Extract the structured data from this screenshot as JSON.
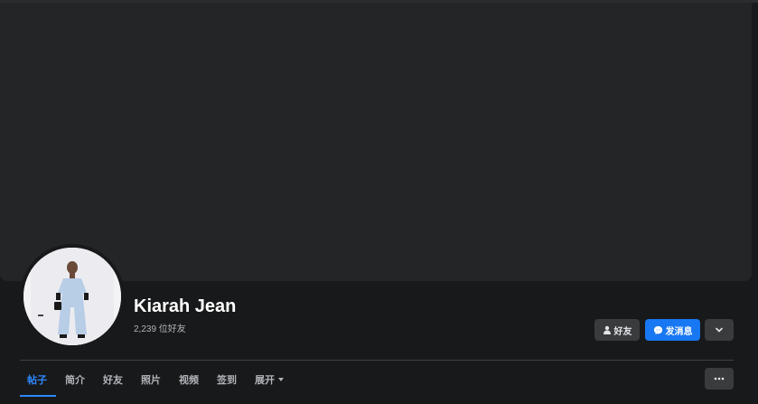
{
  "profile": {
    "name": "Kiarah Jean",
    "friends_count": "2,239 位好友"
  },
  "actions": {
    "friends_label": "好友",
    "message_label": "发消息",
    "more_icon": "chevron-down-icon",
    "overflow_icon": "more-dots-icon"
  },
  "tabs": [
    {
      "label": "帖子",
      "active": true
    },
    {
      "label": "简介"
    },
    {
      "label": "好友"
    },
    {
      "label": "照片"
    },
    {
      "label": "视频"
    },
    {
      "label": "签到"
    },
    {
      "label": "展开"
    }
  ],
  "colors": {
    "accent": "#2d88ff",
    "message_button": "#1877f2",
    "background": "#18191a",
    "cover": "#242526"
  }
}
